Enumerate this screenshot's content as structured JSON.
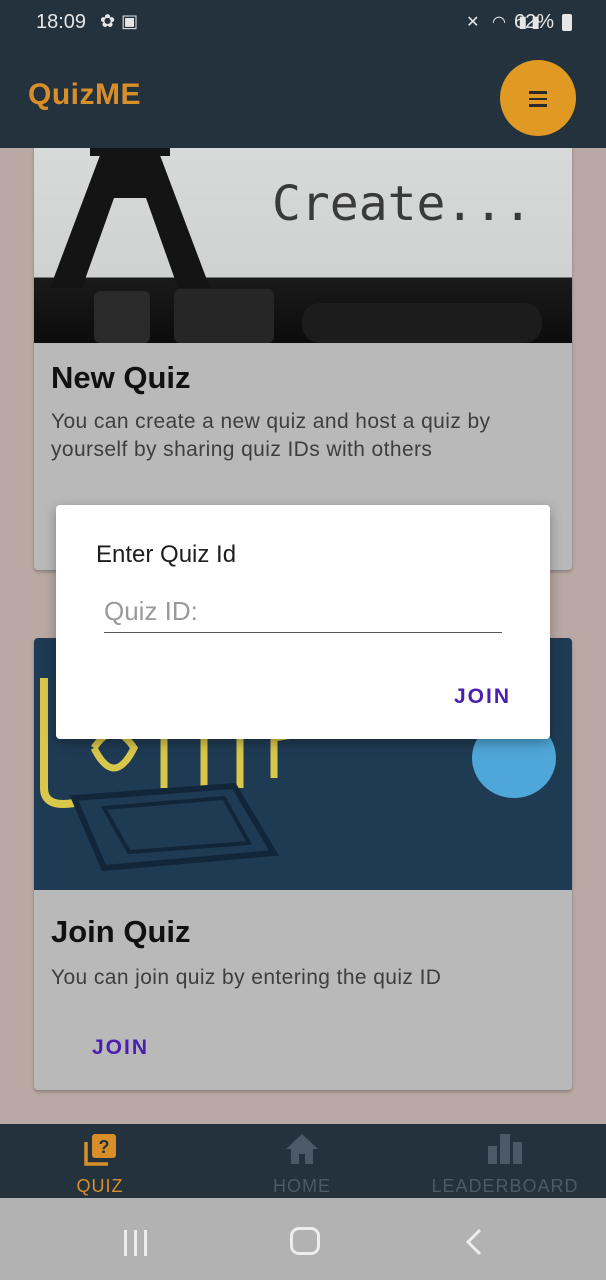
{
  "status_bar": {
    "time": "18:09",
    "left_icons": [
      "notification-icon",
      "image-icon"
    ],
    "right_icons": [
      "mute-icon",
      "wifi-icon",
      "signal-icon"
    ],
    "battery": "62%"
  },
  "app_bar": {
    "title": "QuizME",
    "menu_icon": "hamburger-icon",
    "accent_color": "#e09a24",
    "bar_color": "#24323d"
  },
  "cards": [
    {
      "image_text": "Create...",
      "title": "New Quiz",
      "description": "You can create a new quiz and host a quiz by yourself by sharing quiz IDs with others"
    },
    {
      "title": "Join Quiz",
      "description": "You can join quiz by entering the quiz ID",
      "button": "JOIN"
    }
  ],
  "dialog": {
    "title": "Enter Quiz Id",
    "input_placeholder": "Quiz ID:",
    "input_value": "",
    "join_button": "JOIN",
    "button_color": "#4a1fb0"
  },
  "bottom_nav": {
    "items": [
      {
        "label": "QUIZ",
        "icon": "quiz-icon",
        "active": true
      },
      {
        "label": "HOME",
        "icon": "home-icon",
        "active": false
      },
      {
        "label": "LEADERBOARD",
        "icon": "leaderboard-icon",
        "active": false
      }
    ]
  },
  "system_nav": {
    "buttons": [
      "recent-apps-icon",
      "home-button-icon",
      "back-icon"
    ]
  }
}
